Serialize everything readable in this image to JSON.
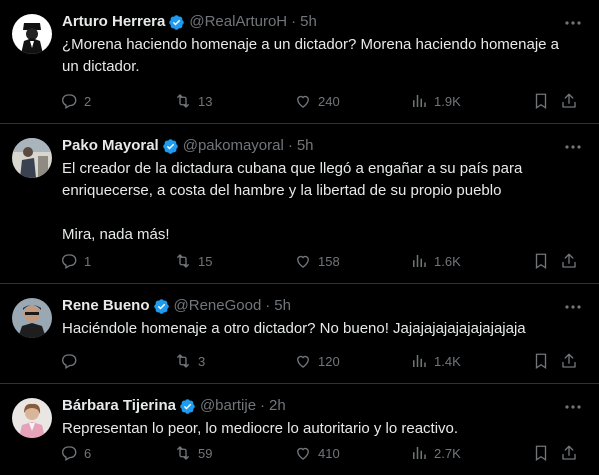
{
  "tweets": [
    {
      "name": "Arturo Herrera",
      "handle": "@RealArturoH",
      "dot": "·",
      "time": "5h",
      "text": "¿Morena haciendo homenaje a un dictador? Morena haciendo homenaje a\nun dictador.",
      "replies": "2",
      "retweets": "13",
      "likes": "240",
      "views": "1.9K"
    },
    {
      "name": "Pako Mayoral",
      "handle": "@pakomayoral",
      "dot": "·",
      "time": "5h",
      "text": "El creador de la dictadura cubana que llegó a engañar a su país para\nenriquecerse, a costa del hambre y la libertad de su propio pueblo\n\nMira, nada más!",
      "replies": "1",
      "retweets": "15",
      "likes": "158",
      "views": "1.6K"
    },
    {
      "name": "Rene Bueno",
      "handle": "@ReneGood",
      "dot": "·",
      "time": "5h",
      "text": "Haciéndole homenaje a otro dictador? No bueno! Jajajajajajajajajajaja",
      "replies": "",
      "retweets": "3",
      "likes": "120",
      "views": "1.4K"
    },
    {
      "name": "Bárbara Tijerina",
      "handle": "@bartije",
      "dot": "·",
      "time": "2h",
      "text": "Representan lo peor, lo mediocre lo autoritario y lo reactivo.",
      "replies": "6",
      "retweets": "59",
      "likes": "410",
      "views": "2.7K"
    }
  ],
  "colors": {
    "background": "#000000",
    "text": "#e7e9ea",
    "muted": "#71767b",
    "divider": "#2f3336",
    "verified": "#1d9bf0"
  },
  "icons": [
    "verified-badge-icon",
    "more-options-icon",
    "reply-icon",
    "retweet-icon",
    "like-icon",
    "views-icon",
    "bookmark-icon",
    "share-icon"
  ]
}
